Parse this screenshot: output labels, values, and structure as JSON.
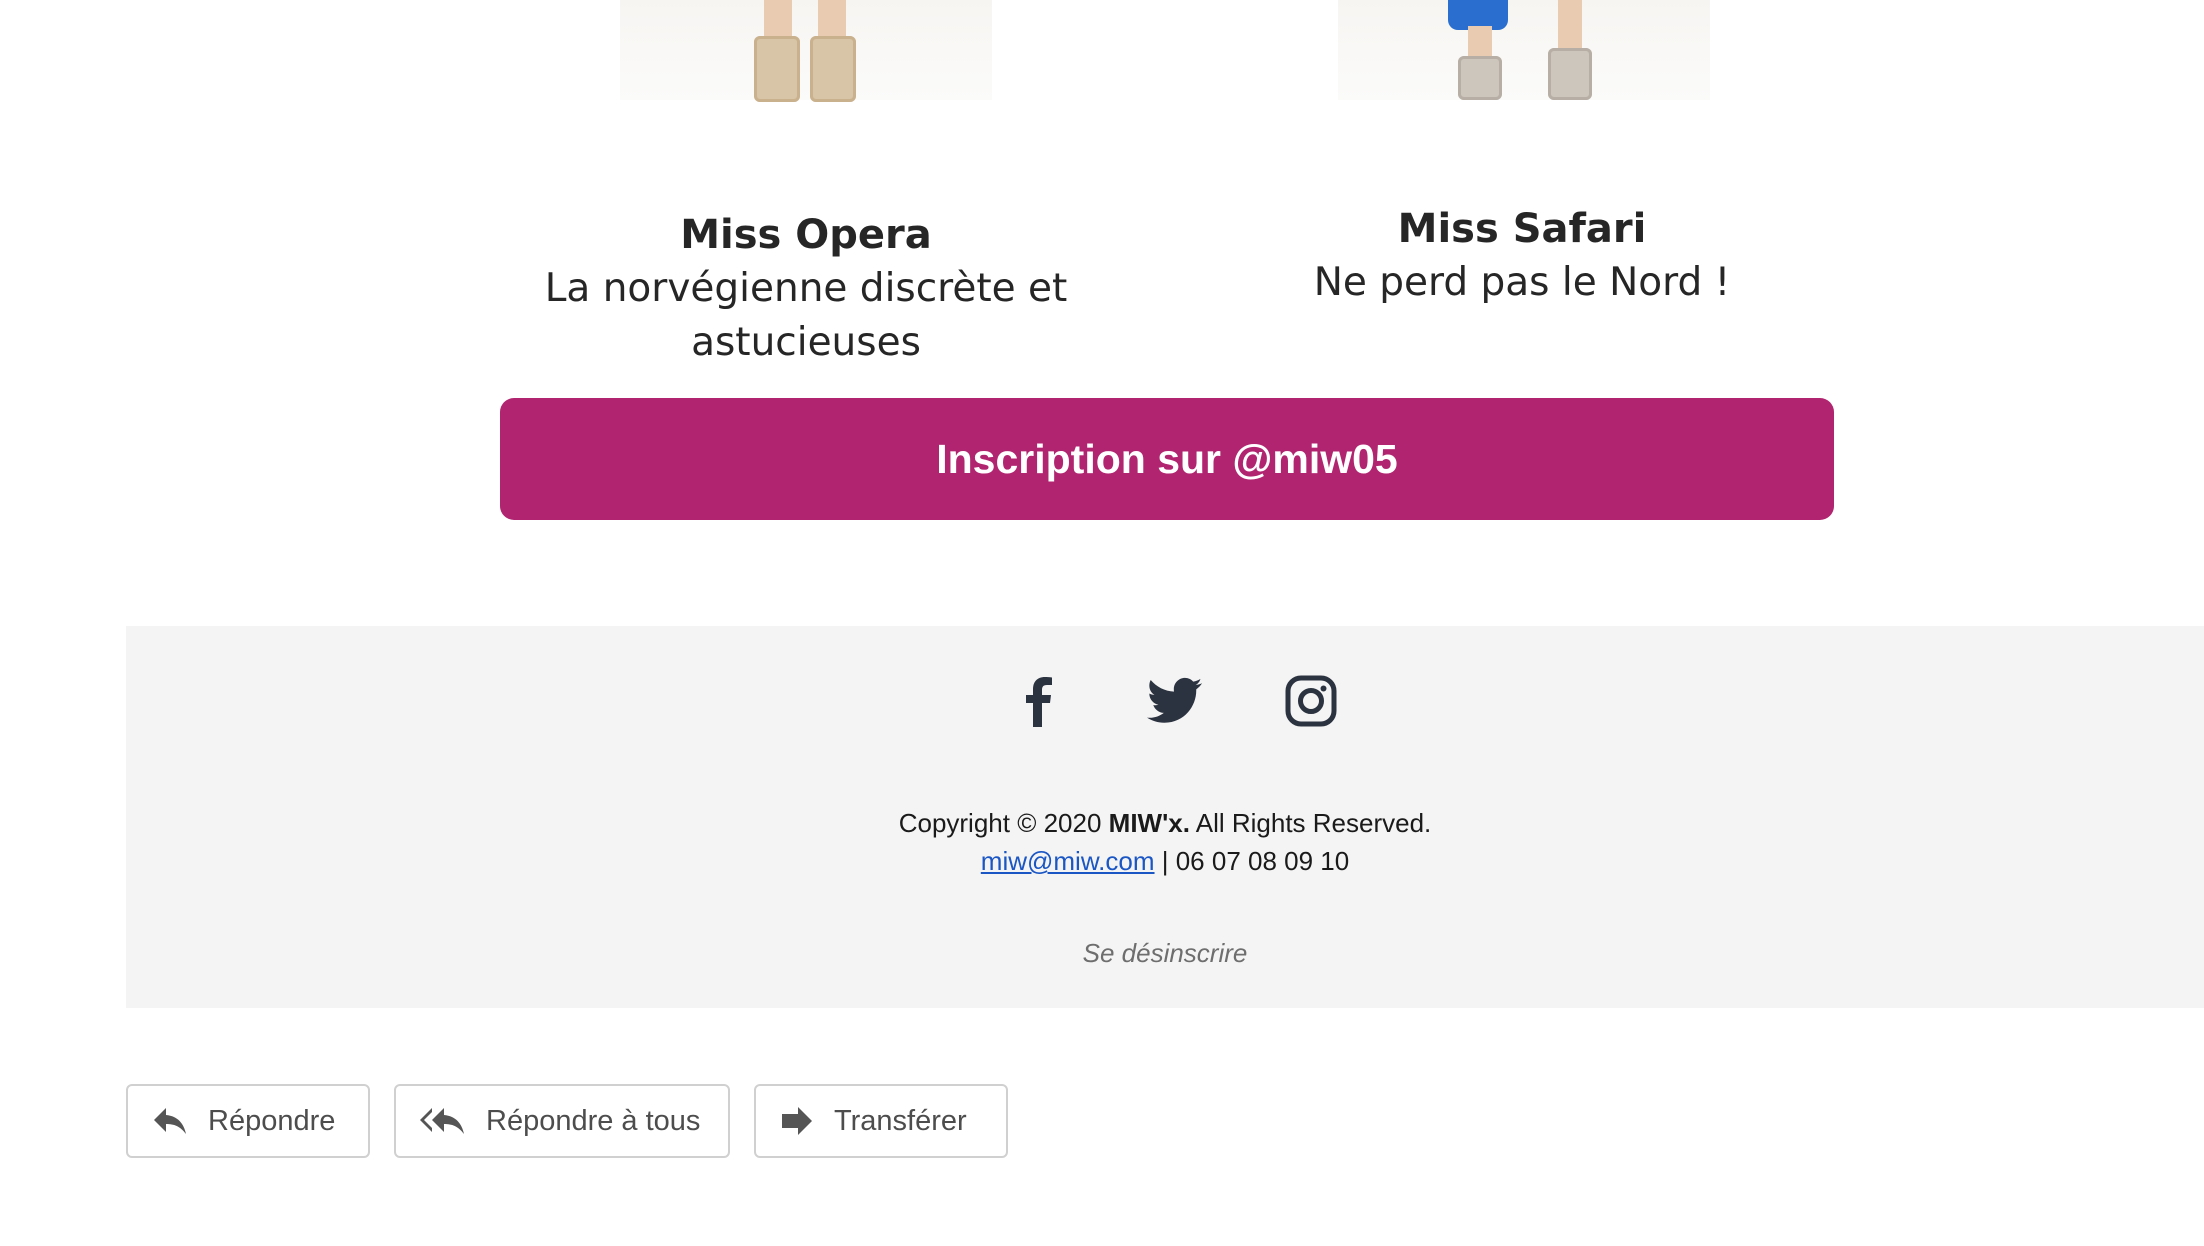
{
  "products": [
    {
      "name": "Miss Opera",
      "description": "La norvégienne discrète et astucieuses"
    },
    {
      "name": "Miss Safari",
      "description": "Ne perd pas le Nord !"
    }
  ],
  "cta": {
    "label": "Inscription sur @miw05",
    "color": "#b12570"
  },
  "footer": {
    "socials": [
      {
        "icon": "facebook-icon"
      },
      {
        "icon": "twitter-icon"
      },
      {
        "icon": "instagram-icon"
      }
    ],
    "copyright_prefix": "Copyright © 2020 ",
    "brand": "MIW'x.",
    "copyright_suffix": " All Rights Reserved.",
    "email": "miw@miw.com",
    "separator": " | ",
    "phone": "06 07 08 09 10",
    "unsubscribe": "Se désinscrire"
  },
  "actions": {
    "reply": "Répondre",
    "reply_all": "Répondre à tous",
    "forward": "Transférer"
  }
}
